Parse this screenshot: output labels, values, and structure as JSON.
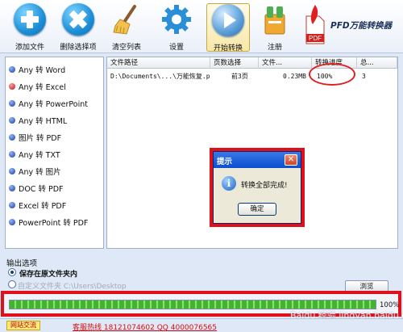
{
  "toolbar": {
    "add_files": "添加文件",
    "delete_selected": "删除选择项",
    "clear_list": "清空列表",
    "settings": "设置",
    "start_convert": "开始转换",
    "register": "注册",
    "brand_pdf": "PDF",
    "brand_name": "PFD万能转换器",
    "icons": [
      "plus-icon",
      "delete-x-icon",
      "broom-icon",
      "gear-icon",
      "play-icon",
      "register-icon",
      "pdf-logo"
    ]
  },
  "left_list": {
    "items": [
      {
        "label": "Any 转 Word"
      },
      {
        "label": "Any 转 Excel",
        "selected": true
      },
      {
        "label": "Any 转 PowerPoint"
      },
      {
        "label": "Any 转 HTML"
      },
      {
        "label": "图片 转 PDF"
      },
      {
        "label": "Any 转 TXT"
      },
      {
        "label": "Any 转 图片"
      },
      {
        "label": "DOC 转 PDF"
      },
      {
        "label": "Excel 转 PDF"
      },
      {
        "label": "PowerPoint 转 PDF"
      }
    ]
  },
  "table": {
    "headers": [
      "文件路径",
      "页数选择",
      "文件...",
      "转换进度",
      "总..."
    ],
    "rows": [
      {
        "path": "D:\\Documents\\...\\万能恢复.pdf",
        "pages": "前3页",
        "size": "0.23MB",
        "progress": "100%",
        "total": "3"
      }
    ]
  },
  "dialog": {
    "title": "提示",
    "message": "转换全部完成!",
    "ok": "确定",
    "close": "✕",
    "info_glyph": "i"
  },
  "output": {
    "label": "输出选项",
    "option1": "保存在原文件夹内",
    "option2": "自定义文件夹 C:\\Users\\Desktop",
    "side_button": "浏览"
  },
  "progress": {
    "value": 1.0,
    "label": "100%"
  },
  "status": {
    "badge": "网站交流",
    "contact": "客服热线 18121074602 QQ 4000076565"
  },
  "watermark": "Baidu 经验 jingyan.baidu.com",
  "colors": {
    "highlight_red": "#e0101a",
    "progress_green": "#3fb62e",
    "title_blue": "#0a4fd0"
  }
}
